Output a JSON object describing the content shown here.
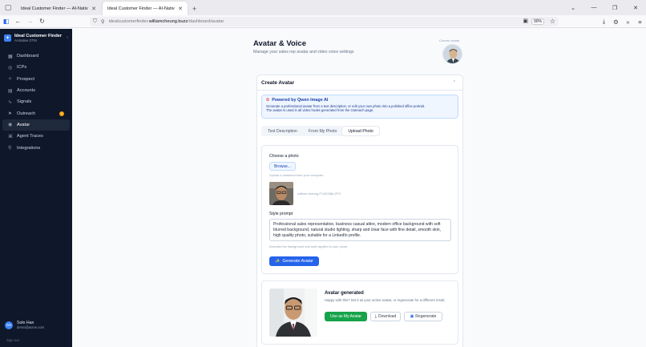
{
  "browser": {
    "tabs": [
      {
        "title": "Ideal Customer Finder — AI-Native",
        "active": false
      },
      {
        "title": "Ideal Customer Finder — AI-Native",
        "active": true
      }
    ],
    "url_prefix": "idealcustomerfinder.",
    "url_domain": "williamcheung.buzz",
    "url_path": "/dashboard/avatar",
    "zoom": "90%"
  },
  "sidebar": {
    "brand_title": "Ideal Customer Finder",
    "brand_subtitle": "AI-Native GTM",
    "items": [
      {
        "label": "Dashboard",
        "icon": "grid-icon"
      },
      {
        "label": "ICPs",
        "icon": "target-icon"
      },
      {
        "label": "Prospect",
        "icon": "sparkle-icon"
      },
      {
        "label": "Accounts",
        "icon": "building-icon"
      },
      {
        "label": "Signals",
        "icon": "signal-icon"
      },
      {
        "label": "Outreach",
        "icon": "send-icon",
        "badge": "2"
      },
      {
        "label": "Avatar",
        "icon": "user-circle-icon",
        "active": true
      },
      {
        "label": "Agent Traces",
        "icon": "trace-icon"
      },
      {
        "label": "Integrations",
        "icon": "plug-icon"
      }
    ],
    "user_initials": "SH",
    "user_name": "Solo Han",
    "user_email": "demo@acme.com",
    "signout_label": "Sign out"
  },
  "page": {
    "title": "Avatar & Voice",
    "subtitle": "Manage your sales rep avatar and video voice settings",
    "current_avatar_label": "Current avatar"
  },
  "create_avatar": {
    "title": "Create Avatar",
    "info_title": "Powered by Qwen Image AI",
    "info_text_1": "Generate a professional avatar from a text description, or edit your own photo into a polished office portrait.",
    "info_text_2": "The avatar is used in all video hooks generated from the Outreach page.",
    "tabs": [
      {
        "label": "Text Description",
        "selected": false
      },
      {
        "label": "From My Photo",
        "selected": false
      },
      {
        "label": "Upload Photo",
        "selected": true
      }
    ],
    "choose_label": "Choose a photo",
    "browse_label": "Browse...",
    "upload_hint": "Upload a headshot from your computer.",
    "filename": "william.cheung.P1100386.JPG",
    "style_label": "Style prompt",
    "style_prompt": "Professional sales representative, business casual attire, modern office background with soft blurred background, natural studio lighting, sharp and clear face with fine detail, smooth skin, high quality photo, suitable for a LinkedIn profile.",
    "style_hint": "Describe the background and style applied to your photo.",
    "generate_label": "Generate Avatar"
  },
  "result": {
    "title": "Avatar generated",
    "text": "Happy with this? Set it as your active avatar, or regenerate for a different result.",
    "use_label": "Use as My Avatar",
    "download_label": "Download",
    "regenerate_label": "Regenerate"
  },
  "colors": {
    "sidebar_bg": "#0f172a",
    "primary": "#2563eb",
    "success": "#16a34a",
    "badge": "#f59e0b"
  }
}
